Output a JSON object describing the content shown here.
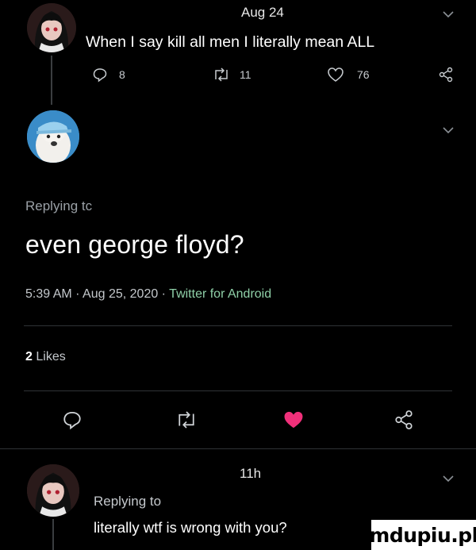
{
  "tweet1": {
    "date": "Aug 24",
    "text": "When I say kill all men I literally mean ALL",
    "replies": "8",
    "retweets": "11",
    "likes": "76"
  },
  "tweet2": {
    "replying_label": "Replying tc",
    "text": "even george floyd?",
    "meta_time": "5:39 AM · Aug 25, 2020 · ",
    "meta_source": "Twitter for Android",
    "likes_count": "2",
    "likes_label": "Likes"
  },
  "tweet3": {
    "time": "11h",
    "replying_label": "Replying to",
    "text": "literally wtf is wrong with you?"
  },
  "watermark": "mdupiu.pl",
  "colors": {
    "background": "#000000",
    "muted": "#8b9096",
    "link": "#8fd0a8",
    "like_heart": "#f0307a"
  }
}
